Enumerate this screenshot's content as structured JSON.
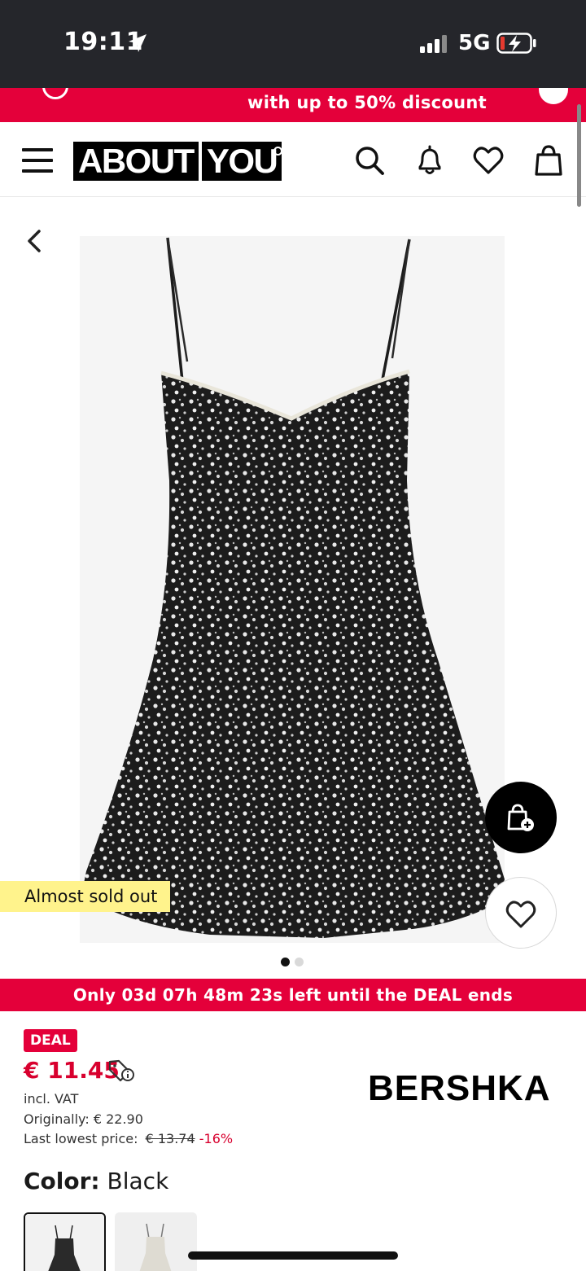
{
  "status_bar": {
    "time": "19:11",
    "network": "5G"
  },
  "promo_banner": {
    "text": "with up to 50% discount"
  },
  "header": {
    "logo_left": "ABOUT",
    "logo_right": "YOU"
  },
  "product": {
    "badge": "Almost sold out",
    "image_count": 2,
    "active_image": 1
  },
  "deal_bar": {
    "text": "Only 03d 07h 48m 23s left until the DEAL ends"
  },
  "pricing": {
    "deal_label": "DEAL",
    "price": "€ 11.45",
    "vat": "incl. VAT",
    "original": "Originally: € 22.90",
    "lowest_label": "Last lowest price:",
    "lowest_value": "€ 13.74",
    "lowest_pct": "-16%"
  },
  "brand": "BERSHKA",
  "color": {
    "label": "Color:",
    "value": "Black",
    "swatches": [
      "black floral",
      "white floral"
    ]
  },
  "colors": {
    "accent": "#e4003a",
    "price": "#d8002e",
    "badge": "#fff38c",
    "status_bar": "#25262b"
  }
}
